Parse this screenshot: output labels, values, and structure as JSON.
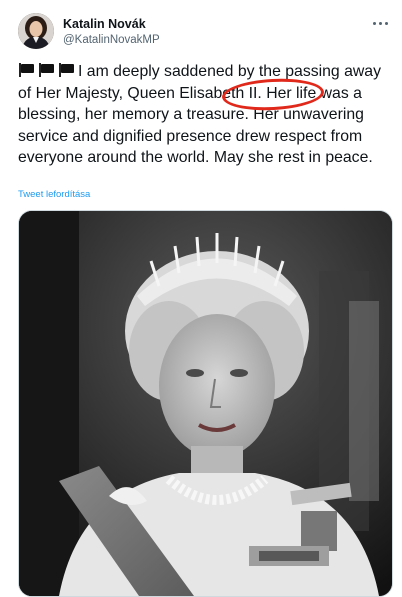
{
  "author": {
    "display_name": "Katalin Novák",
    "handle": "@KatalinNovakMP"
  },
  "tweet": {
    "flags": [
      "black-flag-icon",
      "black-flag-icon",
      "black-flag-icon"
    ],
    "text_before": "I am deeply saddened by the passing away of Her Majesty, Queen ",
    "highlighted": "Elisabeth II",
    "text_after": ". Her life was a blessing, her memory a treasure. Her unwavering service and dignified presence drew respect from everyone around the world. May she rest in peace.",
    "translate_label": "Tweet lefordítása"
  },
  "media": {
    "subject": "black-and-white-portrait-photo"
  },
  "colors": {
    "link": "#1d9bf0",
    "annotation_circle": "#e0281b",
    "secondary_text": "#536471"
  }
}
